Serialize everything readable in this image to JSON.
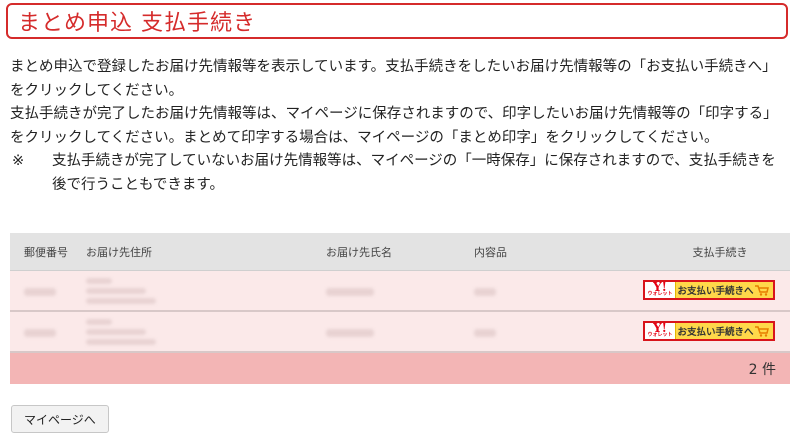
{
  "page_title": "まとめ申込 支払手続き",
  "description": {
    "line1": "まとめ申込で登録したお届け先情報等を表示しています。支払手続きをしたいお届け先情報等の「お支払い手続きへ」をクリックしてください。",
    "line2": "支払手続きが完了したお届け先情報等は、マイページに保存されますので、印字したいお届け先情報等の「印字する」をクリックしてください。まとめて印字する場合は、マイページの「まとめ印字」をクリックしてください。",
    "note_mark": "※",
    "note_text": "支払手続きが完了していないお届け先情報等は、マイページの「一時保存」に保存されますので、支払手続きを後で行うこともできます。"
  },
  "table": {
    "headers": {
      "zip": "郵便番号",
      "address": "お届け先住所",
      "name": "お届け先氏名",
      "item": "内容品",
      "payment": "支払手続き"
    },
    "rows": [
      {
        "pay_button": "お支払い手続きへ"
      },
      {
        "pay_button": "お支払い手続きへ"
      }
    ],
    "count": "2 件"
  },
  "pay_icon": {
    "mark": "Y!",
    "sub": "ウォレット"
  },
  "back_button": "マイページへ",
  "colors": {
    "accent": "#d52b2b",
    "row_bg": "#fbe9e9",
    "footer_bg": "#f3b5b5",
    "pay_button_bg": "#ffd84a"
  }
}
